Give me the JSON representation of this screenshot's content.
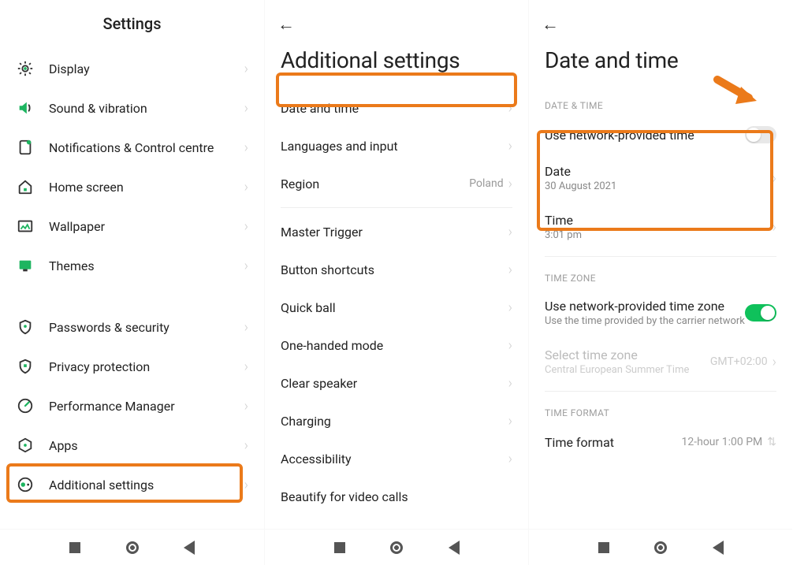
{
  "screen1": {
    "title": "Settings",
    "items": [
      {
        "icon": "display",
        "label": "Display"
      },
      {
        "icon": "sound",
        "label": "Sound & vibration"
      },
      {
        "icon": "notifications",
        "label": "Notifications & Control centre"
      },
      {
        "icon": "home",
        "label": "Home screen"
      },
      {
        "icon": "wallpaper",
        "label": "Wallpaper"
      },
      {
        "icon": "themes",
        "label": "Themes"
      }
    ],
    "items2": [
      {
        "icon": "shield",
        "label": "Passwords & security"
      },
      {
        "icon": "shield2",
        "label": "Privacy protection"
      },
      {
        "icon": "perf",
        "label": "Performance Manager"
      },
      {
        "icon": "apps",
        "label": "Apps"
      },
      {
        "icon": "additional",
        "label": "Additional settings"
      }
    ]
  },
  "screen2": {
    "title": "Additional settings",
    "group1": [
      {
        "label": "Date and time"
      },
      {
        "label": "Languages and input"
      },
      {
        "label": "Region",
        "value": "Poland"
      }
    ],
    "group2": [
      {
        "label": "Master Trigger"
      },
      {
        "label": "Button shortcuts"
      },
      {
        "label": "Quick ball"
      },
      {
        "label": "One-handed mode"
      },
      {
        "label": "Clear speaker"
      },
      {
        "label": "Charging"
      },
      {
        "label": "Accessibility"
      },
      {
        "label": "Beautify for video calls"
      }
    ]
  },
  "screen3": {
    "title": "Date and time",
    "section_datetime_head": "DATE & TIME",
    "net_time": {
      "label": "Use network-provided time",
      "on": false
    },
    "date": {
      "label": "Date",
      "sub": "30 August 2021"
    },
    "time": {
      "label": "Time",
      "sub": "3:01 pm"
    },
    "section_tz_head": "TIME ZONE",
    "net_tz": {
      "label": "Use network-provided time zone",
      "sub": "Use the time provided by the carrier network",
      "on": true
    },
    "select_tz": {
      "label": "Select time zone",
      "sub": "Central European Summer Time",
      "value": "GMT+02:00",
      "disabled": true
    },
    "section_format_head": "TIME FORMAT",
    "time_format": {
      "label": "Time format",
      "value": "12-hour 1:00 PM"
    }
  }
}
